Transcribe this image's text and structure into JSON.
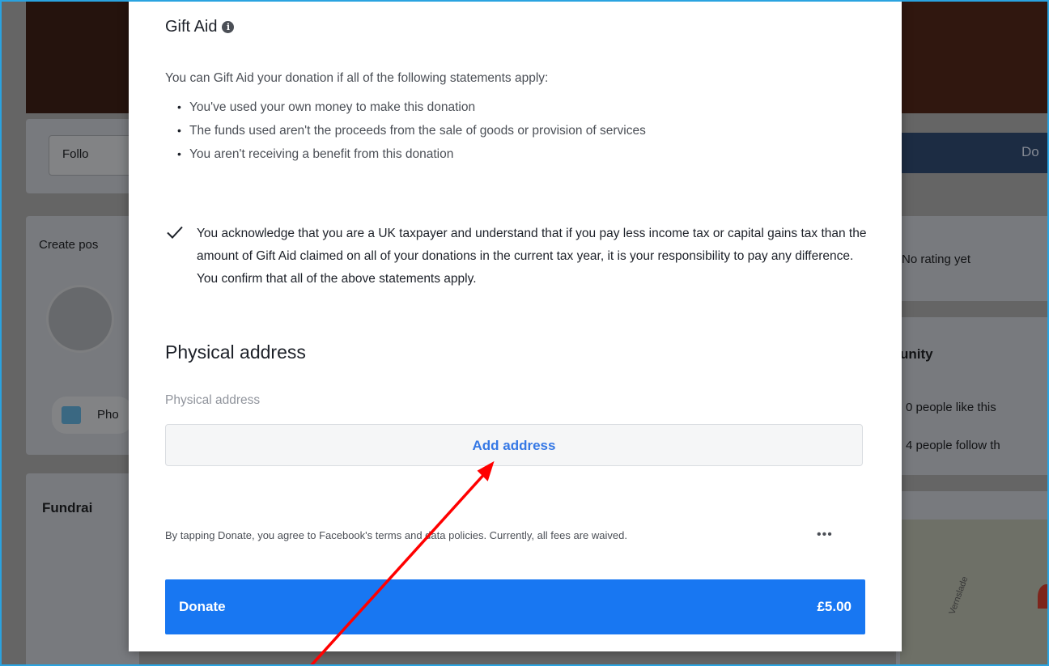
{
  "background": {
    "follow_label": "Follo",
    "donate_label": "Do",
    "create_post_label": "Create pos",
    "photo_label": "Pho",
    "fundraiser_label": "Fundrai",
    "rating_text": "No rating yet",
    "community_heading": "unity",
    "likes_text": "0 people like this",
    "follows_text": "4 people follow th",
    "map_street": "Vernslade"
  },
  "dialog": {
    "title": "Gift Aid",
    "info_icon": "info-circle-icon",
    "intro": "You can Gift Aid your donation if all of the following statements apply:",
    "statements": [
      "You've used your own money to make this donation",
      "The funds used aren't the proceeds from the sale of goods or provision of services",
      "You aren't receiving a benefit from this donation"
    ],
    "acknowledgement_checked": true,
    "acknowledgement": "You acknowledge that you are a UK taxpayer and understand that if you pay less income tax or capital gains tax than the amount of Gift Aid claimed on all of your donations in the current tax year, it is your responsibility to pay any difference. You confirm that all of the above statements apply.",
    "address_heading": "Physical address",
    "address_label": "Physical address",
    "add_address_button": "Add address",
    "terms": "By tapping Donate, you agree to Facebook's terms and data policies. Currently, all fees are waived.",
    "more_icon": "more-dots-icon",
    "donate_button": "Donate",
    "donate_amount": "£5.00"
  },
  "colors": {
    "accent_blue": "#1877f2",
    "link_blue": "#3578e5",
    "annotation_red": "#ff0000",
    "frame_border": "#2aa3e0"
  }
}
